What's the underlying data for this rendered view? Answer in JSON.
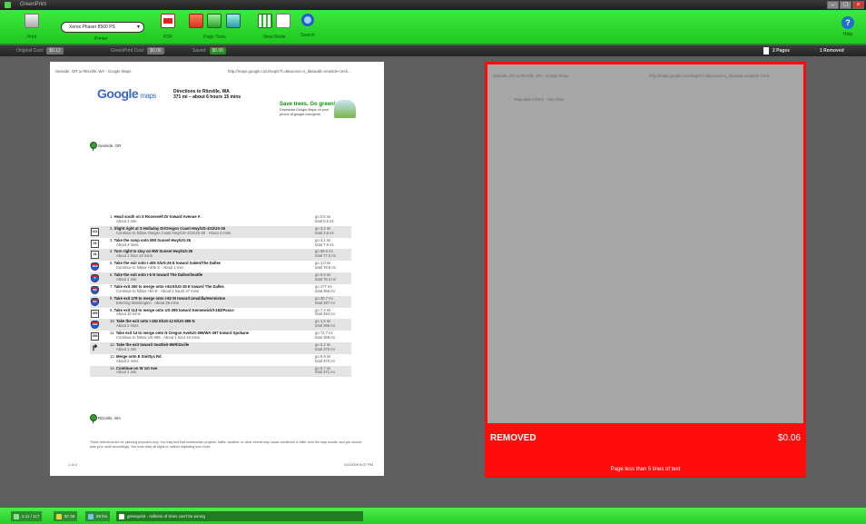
{
  "window": {
    "title": "GreenPrint"
  },
  "toolbar": {
    "print_label": "Print",
    "printer_select": "Xerox Phaser 8560 PS",
    "printer_label": "Printer",
    "pdf_label": "PDF",
    "page_tools_label": "Page Tools",
    "view_mode_label": "View Mode",
    "search_label": "Search",
    "help_label": "Help"
  },
  "statusbar": {
    "original_cost_label": "Original Cost:",
    "original_cost_value": "$0.12",
    "greenprint_cost_label": "GreenPrint Cost:",
    "greenprint_cost_value": "$0.06",
    "saved_label": "Saved:",
    "saved_value": "$0.06",
    "pages": "2 Pages",
    "removed": "1 Removed"
  },
  "page_left": {
    "header_left": "Seaside, OR to Ritzville, WA - Google Maps",
    "header_right": "http://maps.google.com/maps?f=d&source=s_d&saddr=seaside+oreb...",
    "logo_text": "Google",
    "logo_maps": "maps",
    "dir_title": "Directions to Ritzville, WA",
    "dir_sub": "371 mi – about 6 hours 15 mins",
    "save_trees_title": "Save trees. Go green!",
    "save_trees_sub": "Download Google Maps on your phone at google.com/gmm",
    "start_label": "Seaside, OR",
    "end_label": "Ritzville, WA",
    "steps": [
      {
        "num": "1.",
        "text": "Head south on S Roosevelt Dr toward Avenue A",
        "sub": "About 1 min",
        "dist": "go 0.6 mi",
        "total": "total 0.6 mi",
        "sign": "",
        "sign_type": "none",
        "shade": false
      },
      {
        "num": "2.",
        "text": "Slight right at S Holladay Dr/Oregon Coast Hwy/US-101/US-26",
        "sub": "Continue to follow Oregon Coast Hwy/US-101/US-26 · About 4 mins",
        "dist": "go 3.2 mi",
        "total": "total 3.8 mi",
        "sign": "101",
        "sign_type": "box",
        "shade": true
      },
      {
        "num": "3.",
        "text": "Take the ramp onto NW Sunset Hwy/US-26",
        "sub": "About 3 mins",
        "dist": "go 4.1 mi",
        "total": "total 7.9 mi",
        "sign": "26",
        "sign_type": "box",
        "shade": false
      },
      {
        "num": "4.",
        "text": "Turn right to stay on NW Sunset Hwy/US-26",
        "sub": "About 1 hour 10 mins",
        "dist": "go 69.6 mi",
        "total": "total 77.5 mi",
        "sign": "26",
        "sign_type": "box",
        "shade": true
      },
      {
        "num": "5.",
        "text": "Take the exit onto I-405 S/US-26 E toward Salem/The Dalles",
        "sub": "Continue to follow I-405 S · About 1 min",
        "dist": "go 1.0 mi",
        "total": "total 78.5 mi",
        "sign": "405",
        "sign_type": "shield",
        "shade": false
      },
      {
        "num": "6.",
        "text": "Take the exit onto I-5 N toward The Dalles/Seattle",
        "sub": "About 1 min",
        "dist": "go 0.9 mi",
        "total": "total 79.4 mi",
        "sign": "5",
        "sign_type": "shield",
        "shade": true
      },
      {
        "num": "7.",
        "text": "Take exit 300 to merge onto I-84 E/US-30 E toward The Dalles",
        "sub": "Continue to follow I-84 E · About 2 hours 47 mins",
        "dist": "go 177 mi",
        "total": "total 256 mi",
        "sign": "84",
        "sign_type": "shield",
        "shade": false
      },
      {
        "num": "8.",
        "text": "Take exit 179 to merge onto I-82 W toward Umatilla/Hermiston",
        "sub": "Entering Washington · About 28 mins",
        "dist": "go 30.7 mi",
        "total": "total 287 mi",
        "sign": "82",
        "sign_type": "shield",
        "shade": true
      },
      {
        "num": "9.",
        "text": "Take exit 113 to merge onto US-395 toward Kennewick/I-182/Pasco",
        "sub": "About 10 mins",
        "dist": "go 7.4 mi",
        "total": "total 294 mi",
        "sign": "395",
        "sign_type": "box",
        "shade": false
      },
      {
        "num": "10.",
        "text": "Take the exit onto I-182 E/US-12 E/US-395 N",
        "sub": "About 2 mins",
        "dist": "go 1.5 mi",
        "total": "total 296 mi",
        "sign": "182",
        "sign_type": "shield",
        "shade": true
      },
      {
        "num": "11.",
        "text": "Take exit 14 to merge onto N Oregon Ave/US-395/WA-397 toward Spokane",
        "sub": "Continue to follow US-395 · About 1 hour 10 mins",
        "dist": "go 72.7 mi",
        "total": "total 368 mi",
        "sign": "395",
        "sign_type": "box",
        "shade": false
      },
      {
        "num": "12.",
        "text": "Take the exit toward Seattle/I-90/Ritzville",
        "sub": "About 1 min",
        "dist": "go 0.2 mi",
        "total": "total 370 mi",
        "sign": "↱",
        "sign_type": "arrow",
        "shade": true
      },
      {
        "num": "13.",
        "text": "Merge onto E Smittys Rd",
        "sub": "About 2 mins",
        "dist": "go 0.6 mi",
        "total": "total 370 mi",
        "sign": "",
        "sign_type": "none",
        "shade": false
      },
      {
        "num": "14.",
        "text": "Continue on W 1st Ave",
        "sub": "About 1 min",
        "dist": "go 0.7 mi",
        "total": "total 371 mi",
        "sign": "",
        "sign_type": "none",
        "shade": true
      }
    ],
    "footer_note": "These directions are for planning purposes only. You may find that construction projects, traffic, weather, or other events may cause conditions to differ from the map results, and you should plan your route accordingly. You must obey all signs or notices regarding your route.",
    "page_num": "1 of 2",
    "page_date": "6/1/2009 5:07 PM"
  },
  "page_right": {
    "header_left": "Seaside, OR to Ritzville, WA - Google Maps",
    "header_right": "http://maps.google.com/maps?f=d&source=s_d&saddr=seaside+oreb...",
    "body_text": "Map data ©2009 · Tele Atlas",
    "removed_title": "REMOVED",
    "removed_price": "$0.06",
    "removed_reason": "Page less than 5 lines of text"
  },
  "taskbar": {
    "item1": "2.11 / 117",
    "item2": "$7.39",
    "item3": "89 lbs",
    "item4": "greenprint - millions of trees can't be wrong"
  },
  "colors": {
    "toolbar_green": "#2ed62e",
    "removed_red": "#ff0d0d",
    "link_blue": "#3a68c8"
  },
  "icons": [
    "print-icon",
    "pdf-icon",
    "page-tools-icons",
    "view-mode-icon",
    "search-icon",
    "help-icon",
    "page-icon"
  ]
}
